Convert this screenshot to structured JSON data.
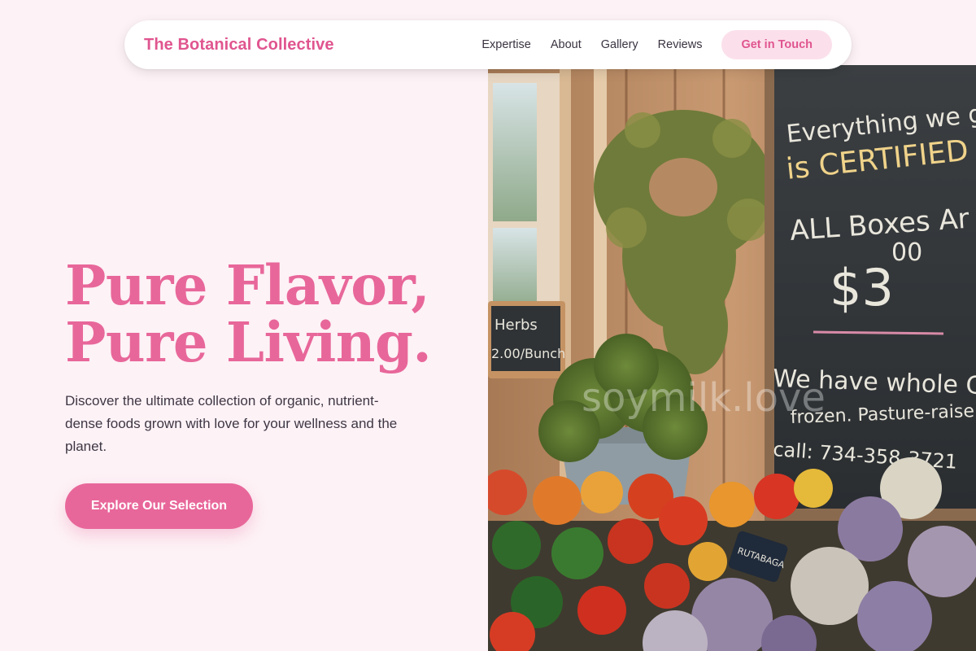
{
  "header": {
    "brand": "The Botanical Collective",
    "nav": [
      {
        "label": "Expertise"
      },
      {
        "label": "About"
      },
      {
        "label": "Gallery"
      },
      {
        "label": "Reviews"
      }
    ],
    "cta_label": "Get in Touch"
  },
  "hero": {
    "title_line1": "Pure Flavor,",
    "title_line2": "Pure Living.",
    "subtitle": "Discover the ultimate collection of organic, nutrient-dense foods grown with love for your wellness and the planet.",
    "button_label": "Explore Our Selection"
  },
  "image": {
    "watermark": "soymilk.love",
    "chalkboard_lines": [
      "Everything we gr",
      "is CERTIFIED ORG",
      "ALL Boxes Ar",
      "$3",
      "00",
      "We have whole CHIC",
      "frozen. Pasture-raise",
      "call: 734-358-3721"
    ],
    "herbs_sign": [
      "Herbs",
      "2.00/Bunch"
    ],
    "produce_tag": "RUTABAGA"
  },
  "colors": {
    "accent": "#e8679a",
    "accent_dark": "#e0558f",
    "accent_soft": "#fbe0eb",
    "background": "#fdf2f6",
    "text": "#3e3744"
  }
}
